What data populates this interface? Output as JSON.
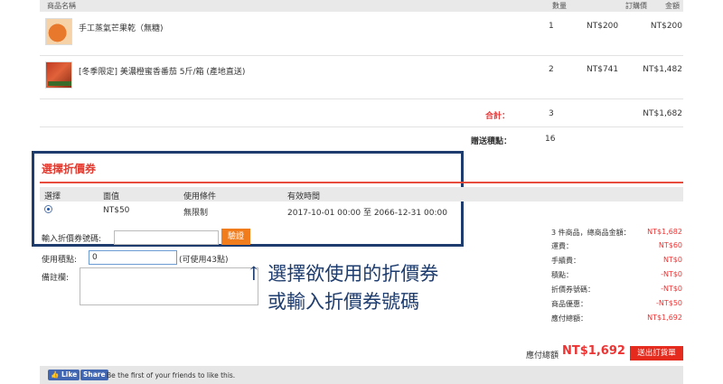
{
  "table": {
    "headers": {
      "name": "商品名稱",
      "qty": "數量",
      "price": "訂購價",
      "amount": "金額"
    },
    "rows": [
      {
        "name": "手工蒸氣芒果乾（無糖)",
        "qty": "1",
        "price": "NT$200",
        "amount": "NT$200"
      },
      {
        "name": "[冬季限定] 美濃橙蜜香番茄 5斤/箱 (產地直送)",
        "qty": "2",
        "price": "NT$741",
        "amount": "NT$1,482"
      }
    ],
    "total_label": "合計：",
    "total_qty": "3",
    "total_amount": "NT$1,682",
    "points_label": "贈送積點：",
    "points_value": "16"
  },
  "coupon": {
    "title": "選擇折價券",
    "headers": {
      "select": "選擇",
      "value": "面值",
      "condition": "使用條件",
      "period": "有效時間"
    },
    "row": {
      "value": "NT$50",
      "condition": "無限制",
      "period": "2017-10-01 00:00 至 2066-12-31 00:00"
    },
    "code_label": "輸入折價券號碼:",
    "code_value": "",
    "verify_label": "驗證"
  },
  "form": {
    "points_label": "使用積點:",
    "points_value": "0",
    "points_hint": "(可使用43點)",
    "memo_label": "備註欄:"
  },
  "annotation": {
    "line1": "↑ 選擇欲使用的折價券",
    "line2": "或輸入折價券號碼"
  },
  "summary": {
    "items": [
      {
        "label": "3 件商品，總商品金額：",
        "value": "NT$1,682"
      },
      {
        "label": "運費：",
        "value": "NT$60"
      },
      {
        "label": "手續費：",
        "value": "NT$0"
      },
      {
        "label": "積點：",
        "value": "-NT$0"
      },
      {
        "label": "折價券號碼：",
        "value": "-NT$0"
      },
      {
        "label": "商品優惠：",
        "value": "-NT$50"
      },
      {
        "label": "應付總額：",
        "value": "NT$1,692"
      }
    ],
    "grand_label": "應付總額",
    "grand_value": "NT$1,692",
    "submit_label": "送出訂貨單"
  },
  "facebook": {
    "like_label": "Like",
    "share_label": "Share",
    "text": "Be the first of your friends to like this."
  },
  "colors": {
    "accent_red": "#e33333",
    "annot_blue": "#1e3c6e",
    "button_orange": "#f07c1c"
  }
}
